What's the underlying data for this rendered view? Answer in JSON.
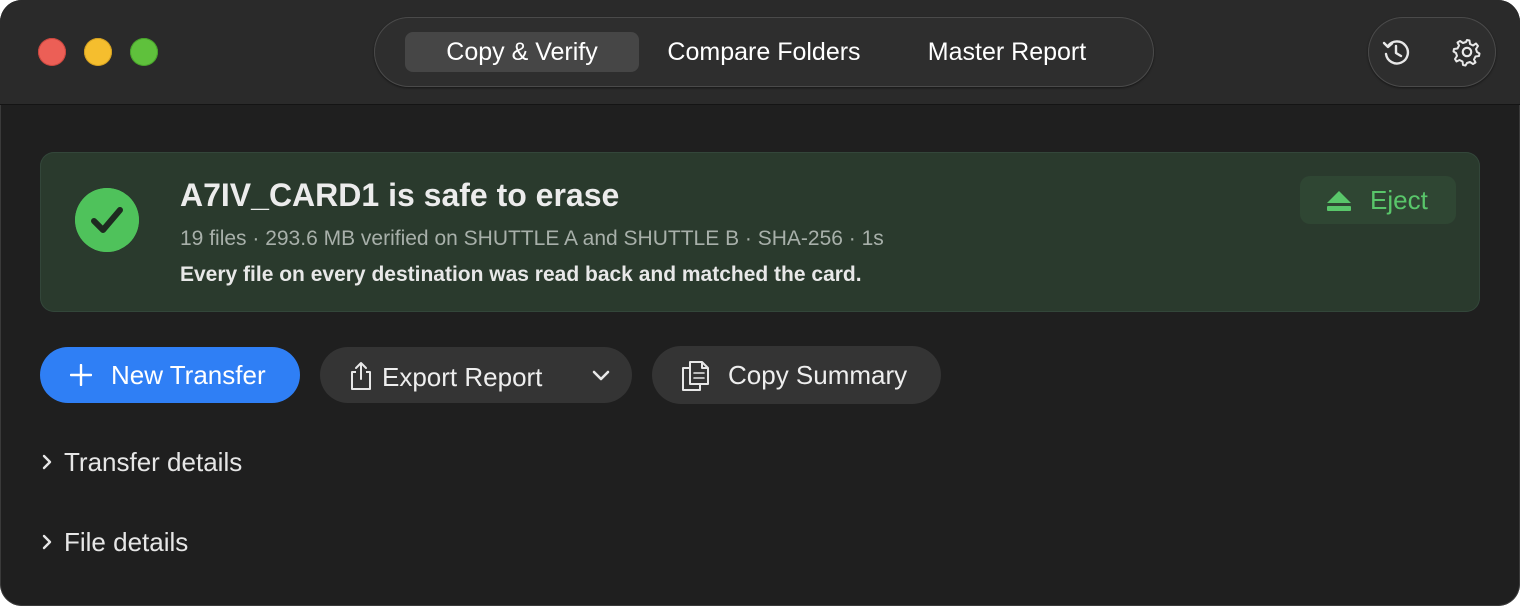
{
  "window": {
    "controls": [
      "close",
      "minimize",
      "zoom"
    ]
  },
  "tabs": [
    {
      "label": "Copy & Verify",
      "active": true
    },
    {
      "label": "Compare Folders",
      "active": false
    },
    {
      "label": "Master Report",
      "active": false
    }
  ],
  "toolbar": {
    "history_icon": "history-icon",
    "settings_icon": "gear-icon"
  },
  "banner": {
    "status": "success",
    "title": "A7IV_CARD1 is safe to erase",
    "meta": "19 files · 293.6 MB verified on SHUTTLE A and SHUTTLE B · SHA-256 · 1s",
    "message": "Every file on every destination was read back and matched the card.",
    "eject_label": "Eject",
    "accent_color": "#4fc25b"
  },
  "actions": {
    "new_transfer": "New Transfer",
    "export_report": "Export Report",
    "copy_summary": "Copy Summary",
    "primary_color": "#2f7ff5"
  },
  "sections": [
    {
      "label": "Transfer details",
      "expanded": false
    },
    {
      "label": "File details",
      "expanded": false
    }
  ]
}
